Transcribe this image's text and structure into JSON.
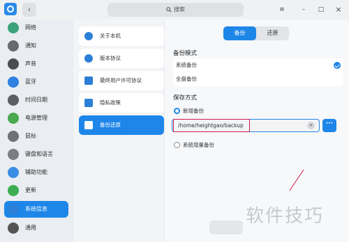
{
  "search": {
    "placeholder": "搜索"
  },
  "window_controls": {
    "menu": "≡",
    "minimize": "–",
    "maximize": "□",
    "close": "×"
  },
  "sidebar": {
    "items": [
      {
        "label": "网络",
        "icon": "network-icon",
        "color": "#3aa37c"
      },
      {
        "label": "通知",
        "icon": "bell-icon",
        "color": "#666a70"
      },
      {
        "label": "声音",
        "icon": "speaker-icon",
        "color": "#4a4d52"
      },
      {
        "label": "蓝牙",
        "icon": "bluetooth-icon",
        "color": "#2f80e0"
      },
      {
        "label": "时间日期",
        "icon": "clock-icon",
        "color": "#5b5e63"
      },
      {
        "label": "电源管理",
        "icon": "battery-icon",
        "color": "#4aa84e"
      },
      {
        "label": "鼠标",
        "icon": "mouse-icon",
        "color": "#6e7177"
      },
      {
        "label": "键盘和语言",
        "icon": "keyboard-icon",
        "color": "#7a7d82"
      },
      {
        "label": "辅助功能",
        "icon": "accessibility-icon",
        "color": "#3a8ee6"
      },
      {
        "label": "更新",
        "icon": "update-icon",
        "color": "#3cae52"
      },
      {
        "label": "系统信息",
        "icon": "monitor-icon",
        "color": "#2b7fd6"
      },
      {
        "label": "通用",
        "icon": "general-icon",
        "color": "#555"
      }
    ],
    "active_index": 10
  },
  "midpanel": {
    "items": [
      {
        "label": "关于本机",
        "icon": "info-icon"
      },
      {
        "label": "版本协议",
        "icon": "copyright-icon"
      },
      {
        "label": "最终用户许可协议",
        "icon": "document-icon"
      },
      {
        "label": "隐私政策",
        "icon": "privacy-icon"
      },
      {
        "label": "备份还原",
        "icon": "backup-icon"
      }
    ],
    "active_index": 4
  },
  "content": {
    "tabs": {
      "backup": "备份",
      "restore": "还原"
    },
    "backup_mode_title": "备份模式",
    "options": [
      "系统备份",
      "全盘备份"
    ],
    "save_method_title": "保存方式",
    "new_backup": "新增备份",
    "path_value": "/home/heightgao/backup",
    "clear": "×",
    "more": "···",
    "incremental_backup": "系统增量备份"
  },
  "watermark": "软件技巧",
  "colors": {
    "accent": "#1e86e8",
    "highlight": "#d11a4a"
  }
}
